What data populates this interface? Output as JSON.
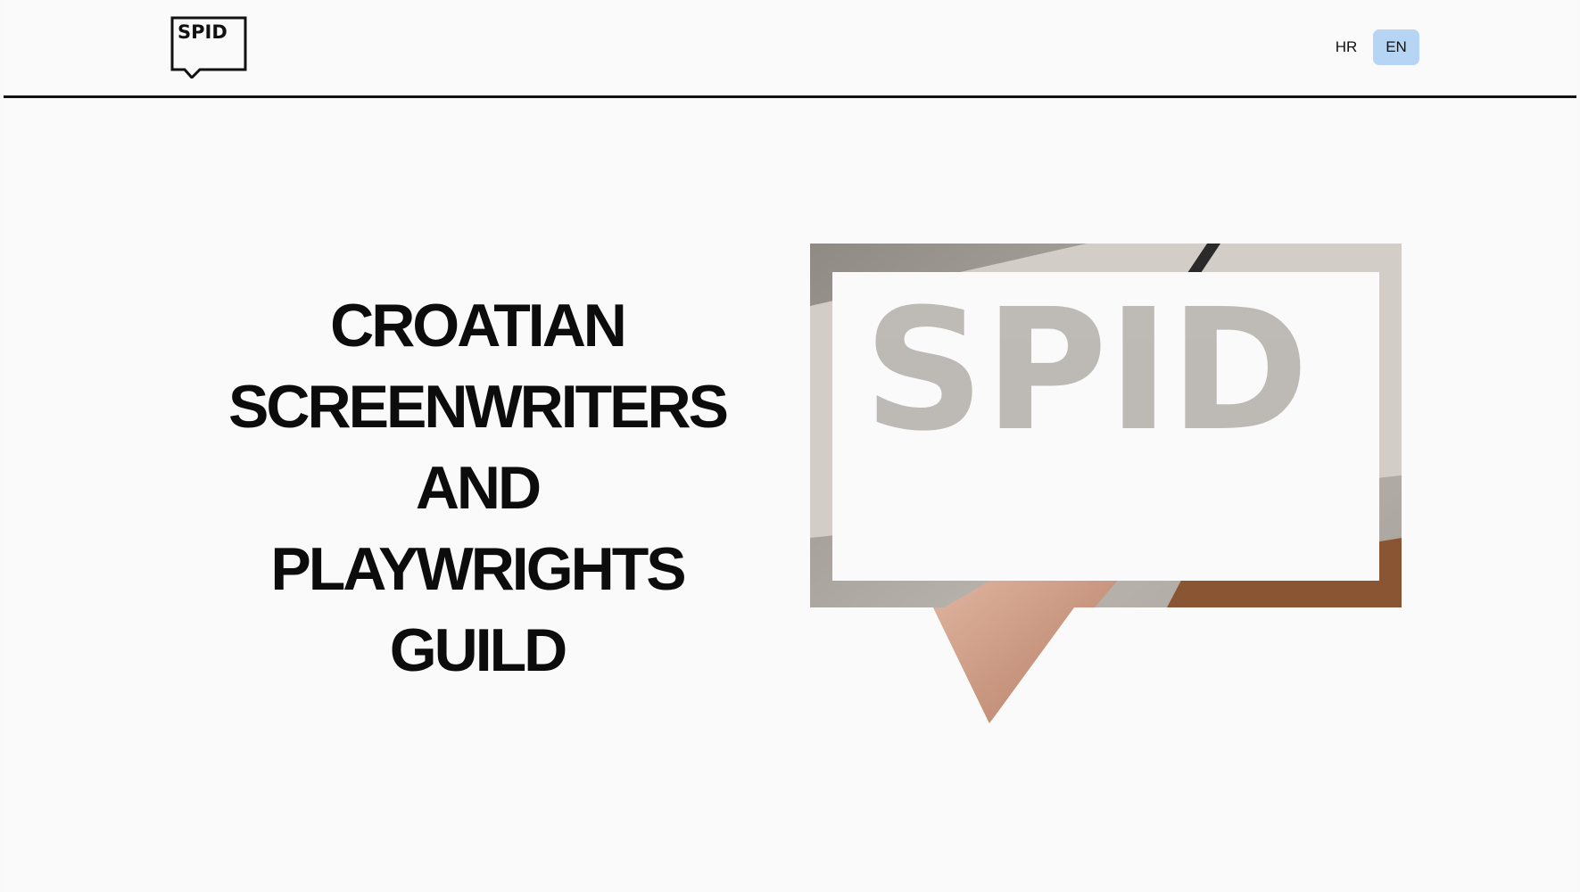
{
  "header": {
    "logo_text": "SPID",
    "languages": [
      {
        "code": "HR",
        "active": false
      },
      {
        "code": "EN",
        "active": true
      }
    ],
    "active_color": "#b6d4f4"
  },
  "hero": {
    "title_lines": [
      "CROATIAN",
      "SCREENWRITERS",
      "AND",
      "PLAYWRIGHTS",
      "GUILD"
    ],
    "graphic_word": "SPID"
  }
}
